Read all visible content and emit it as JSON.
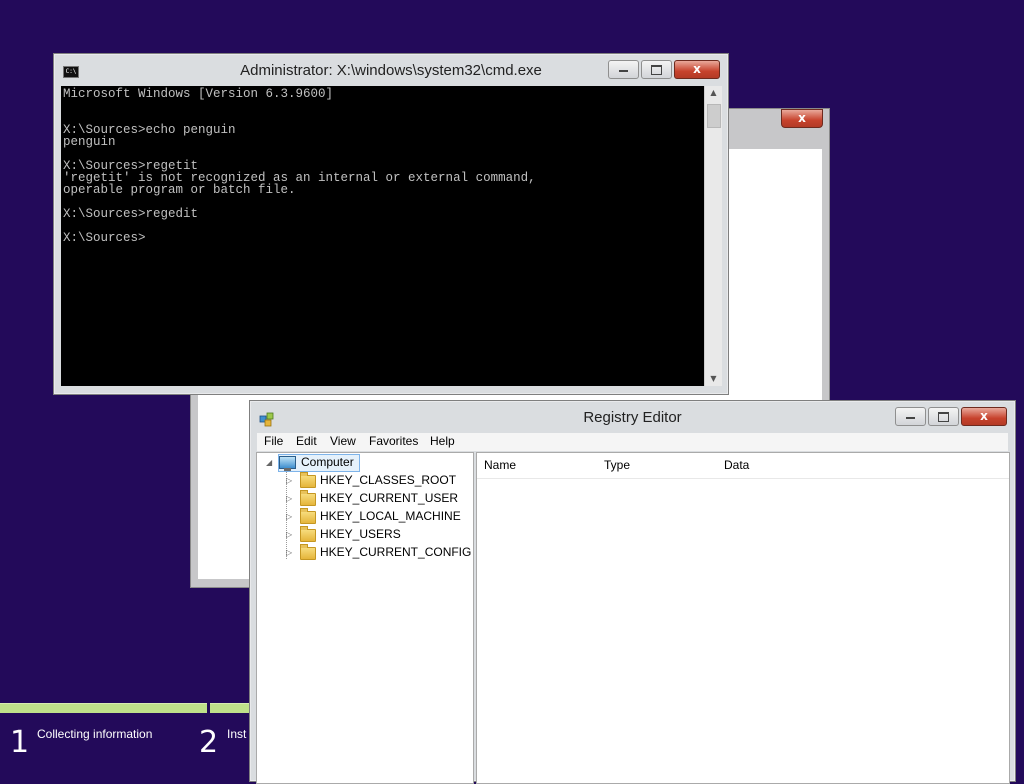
{
  "setup": {
    "steps": [
      {
        "number": "1",
        "label": "Collecting information"
      },
      {
        "number": "2",
        "label": "Inst"
      }
    ],
    "colors": {
      "background": "#230a5a",
      "progress": "#bfe08a"
    }
  },
  "background_dialog": {
    "close_glyph": "x"
  },
  "cmd": {
    "title": "Administrator: X:\\windows\\system32\\cmd.exe",
    "icon_text": "C:\\",
    "lines": [
      "Microsoft Windows [Version 6.3.9600]",
      "",
      "",
      "X:\\Sources>echo penguin",
      "penguin",
      "",
      "X:\\Sources>regetit",
      "'regetit' is not recognized as an internal or external command,",
      "operable program or batch file.",
      "",
      "X:\\Sources>regedit",
      "",
      "X:\\Sources>"
    ],
    "scroll_up": "▲",
    "scroll_down": "▼"
  },
  "regedit": {
    "title": "Registry Editor",
    "menu": [
      "File",
      "Edit",
      "View",
      "Favorites",
      "Help"
    ],
    "tree": {
      "root": "Computer",
      "root_expander": "◢",
      "keys": [
        "HKEY_CLASSES_ROOT",
        "HKEY_CURRENT_USER",
        "HKEY_LOCAL_MACHINE",
        "HKEY_USERS",
        "HKEY_CURRENT_CONFIG"
      ],
      "key_expander": "▷"
    },
    "columns": [
      "Name",
      "Type",
      "Data"
    ]
  },
  "window_buttons": {
    "close": "x"
  }
}
